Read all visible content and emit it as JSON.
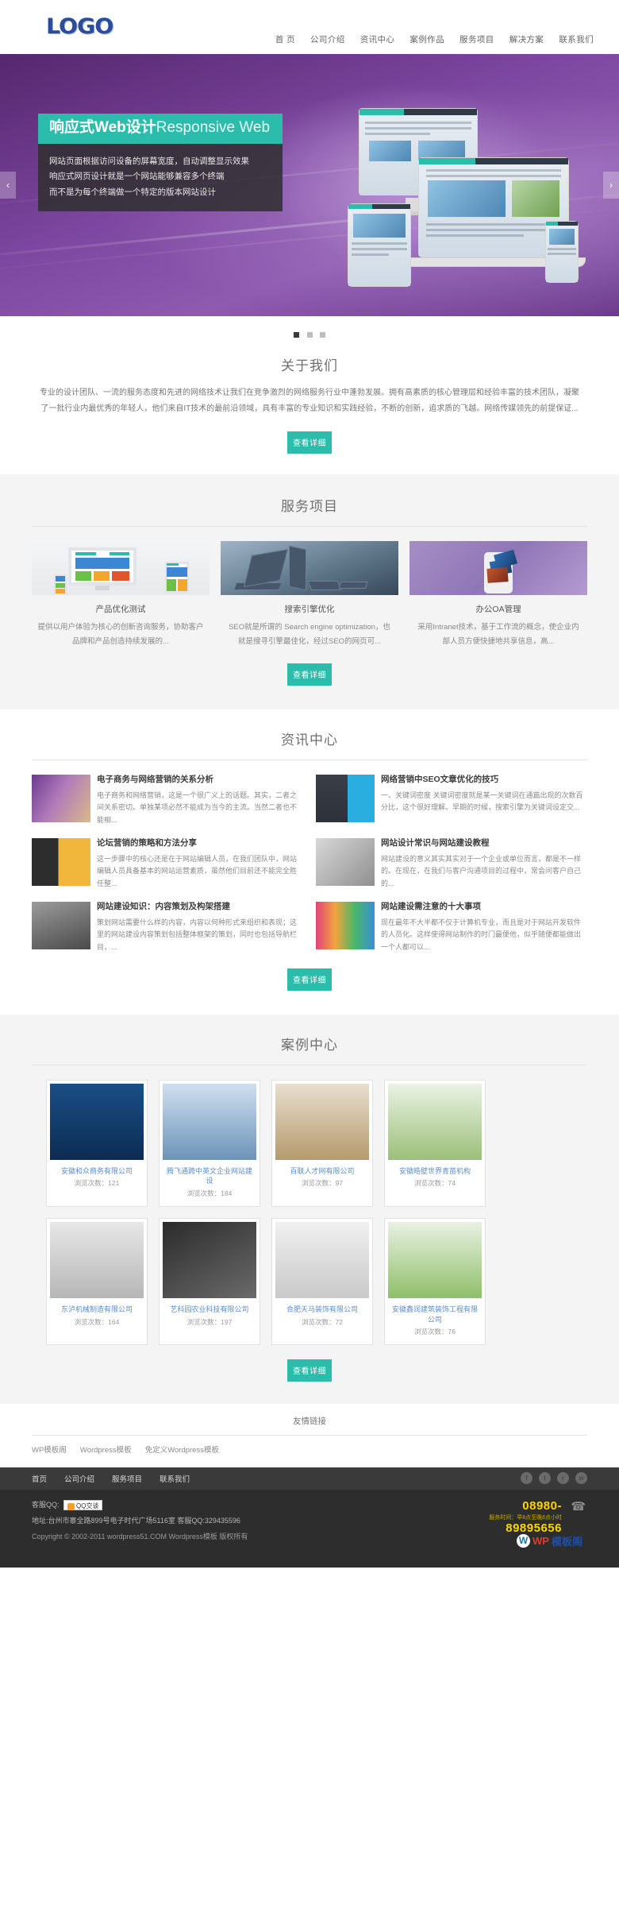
{
  "header": {
    "logo": "LOGO",
    "nav": [
      {
        "label": "首 页",
        "active": true
      },
      {
        "label": "公司介绍",
        "active": false
      },
      {
        "label": "资讯中心",
        "active": false
      },
      {
        "label": "案例作品",
        "active": false
      },
      {
        "label": "服务项目",
        "active": false
      },
      {
        "label": "解决方案",
        "active": false
      },
      {
        "label": "联系我们",
        "active": false
      }
    ]
  },
  "banner": {
    "title_bold": "响应式Web设计",
    "title_light": "Responsive Web",
    "desc_lines": [
      "网站页面根据访问设备的屏幕宽度，自动调整显示效果",
      "响应式网页设计就是一个网站能够兼容多个终端",
      "而不是为每个终端做一个特定的版本网站设计"
    ],
    "arrow_left": "‹",
    "arrow_right": "›",
    "accent_color": "#2bbcab",
    "bg_color": "#7c47a0"
  },
  "about": {
    "title": "关于我们",
    "body": "专业的设计团队、一流的服务态度和先进的网络技术让我们在竞争激烈的网络服务行业中蓬勃发展。拥有高素质的核心管理层和经验丰富的技术团队，凝聚了一批行业内最优秀的年轻人，他们来自IT技术的最前沿领域，具有丰富的专业知识和实践经验，不断的创新，追求质的飞越。网络传媒领先的前提保证...",
    "more": "查看详细"
  },
  "services": {
    "title": "服务项目",
    "more": "查看详细",
    "items": [
      {
        "name": "产品优化测试",
        "desc": "提供以用户体验为核心的创新咨询服务，协助客户品牌和产品创造持续发展的..."
      },
      {
        "name": "搜索引擎优化",
        "desc": "SEO就是所谓的 Search engine optimization，也就是搜寻引擎最佳化，经过SEO的网页可..."
      },
      {
        "name": "办公OA管理",
        "desc": "采用Intranet技术，基于工作流的概念，使企业内部人员方便快捷地共享信息，高..."
      }
    ]
  },
  "news": {
    "title": "资讯中心",
    "more": "查看详细",
    "items": [
      {
        "title": "电子商务与网络营销的关系分析",
        "excerpt": "电子商务和网络营销，这是一个很广义上的话题。其实，二者之间关系密切。单独某项必然不能成为当今的主流。当然二者也不能相..."
      },
      {
        "title": "网络营销中SEO文章优化的技巧",
        "excerpt": "一、关键词密度 关键词密度就是某一关键词在通篇出现的次数百分比，这个很好理解。早期的时候，搜索引擎为关键词设定交..."
      },
      {
        "title": "论坛营销的策略和方法分享",
        "excerpt": "这一步骤中的核心还是在于网站编辑人员，在我们团队中，网站编辑人员具备基本的网站运营素质，虽然他们目前还不能完全胜任整..."
      },
      {
        "title": "网站设计常识与网站建设教程",
        "excerpt": "网站建设的意义其实其实对于一个企业或单位而言，都是不一样的。在现在，在我们与客户沟通项目的过程中，常会问客户自己的..."
      },
      {
        "title": "网站建设知识：内容策划及构架搭建",
        "excerpt": "策划网站需要什么样的内容，内容以何种形式来组织和表现；这里的网站建设内容策划包括整体框架的策划，同时也包括导航栏目，..."
      },
      {
        "title": "网站建设需注意的十大事项",
        "excerpt": "现在最年不大半都不仅于计算机专业，而且是对于网站开发软件的人员化。这样使得网站制作的时门最便他，似乎随便都能做出一个人都可以..."
      }
    ]
  },
  "cases": {
    "title": "案例中心",
    "more": "查看详细",
    "hits_label": "浏览次数：",
    "items": [
      {
        "name": "安徽和众商务有限公司",
        "hits": "121"
      },
      {
        "name": "腾飞通跨中英文企业网站建设",
        "hits": "184"
      },
      {
        "name": "百联人才网有限公司",
        "hits": "97"
      },
      {
        "name": "安徽皓壁世界青苗机构",
        "hits": "74"
      },
      {
        "name": "东泸机械制造有限公司",
        "hits": "164"
      },
      {
        "name": "艺科园农业科技有限公司",
        "hits": "197"
      },
      {
        "name": "合肥天马装饰有限公司",
        "hits": "72"
      },
      {
        "name": "安徽鑫润建筑装饰工程有限公司",
        "hits": "76"
      }
    ]
  },
  "friendlinks": {
    "title": "友情链接",
    "items": [
      "WP模板阁",
      "Wordpress模板",
      "免定义Wordpress模板"
    ]
  },
  "footer": {
    "nav": [
      "首页",
      "公司介绍",
      "服务项目",
      "联系我们"
    ],
    "social_icons": [
      "facebook-icon",
      "twitter-icon",
      "rss-icon",
      "weibo-icon"
    ],
    "service_qq_label": "客服QQ:",
    "qq_button": "QQ交谈",
    "address": "地址:台州市寨全路899号电子时代广场5116室 客服QQ:329435596",
    "copyright": "Copyright © 2002-2011 wordpress51.COM Wordpress模板 版权所有",
    "phone_line1": "08980-",
    "phone_line2": "89895656",
    "phone_note": "服务时间：早8点至晚8点小时",
    "brand_wp": "WP",
    "brand_cn": "模板阁"
  }
}
